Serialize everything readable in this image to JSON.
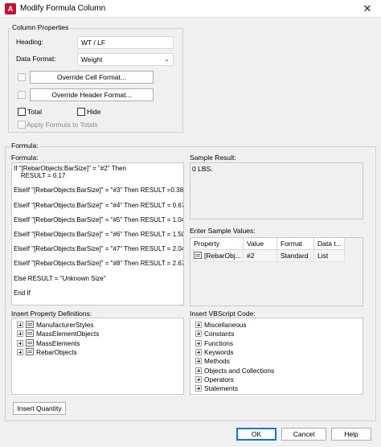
{
  "window": {
    "title": "Modify Formula Column",
    "app_icon_letter": "A",
    "close_glyph": "✕"
  },
  "column_properties": {
    "legend": "Column Properties",
    "heading_label": "Heading:",
    "heading_value": "WT / LF",
    "data_format_label": "Data Format:",
    "data_format_value": "Weight",
    "override_cell_button": "Override Cell Format...",
    "override_header_button": "Override Header Format...",
    "total_label": "Total",
    "hide_label": "Hide",
    "apply_formula_label": "Apply Formula to Totals"
  },
  "formula": {
    "group_legend": "Formula:",
    "label": "Formula:",
    "lines": [
      "If \"[RebarObjects:BarSize]\" = \"#2\" Then",
      "    RESULT = 0.17",
      "",
      "ElseIf \"[RebarObjects:BarSize]\" = \"#3\" Then RESULT =0.38",
      "",
      "ElseIf \"[RebarObjects:BarSize]\" = \"#4\" Then RESULT = 0.67",
      "",
      "ElseIf \"[RebarObjects:BarSize]\" = \"#5\" Then RESULT = 1.04",
      "",
      "ElseIf \"[RebarObjects:BarSize]\" = \"#6\" Then RESULT = 1.50",
      "",
      "ElseIf \"[RebarObjects:BarSize]\" = \"#7\" Then RESULT = 2.04",
      "",
      "ElseIf \"[RebarObjects:BarSize]\" = \"#8\" Then RESULT = 2.67",
      "",
      "Else RESULT = \"Unknown Size\"",
      "",
      "End If"
    ]
  },
  "sample_result": {
    "label": "Sample Result:",
    "value": "0 LBS."
  },
  "sample_values": {
    "label": "Enter Sample Values:",
    "columns": [
      "Property",
      "Value",
      "Format",
      "Data t..."
    ],
    "rows": [
      [
        "[RebarObj...",
        "#2",
        "Standard",
        "List"
      ]
    ]
  },
  "property_definitions": {
    "label": "Insert Property Definitions:",
    "items": [
      "ManufacturerStyles",
      "MassElementObjects",
      "MassElements",
      "RebarObjects"
    ]
  },
  "vbscript": {
    "label": "Insert VBScript Code:",
    "items": [
      "Miscellaneous",
      "Constants",
      "Functions",
      "Keywords",
      "Methods",
      "Objects and Collections",
      "Operators",
      "Statements"
    ]
  },
  "buttons": {
    "insert_quantity": "Insert Quantity",
    "ok": "OK",
    "cancel": "Cancel",
    "help": "Help"
  }
}
